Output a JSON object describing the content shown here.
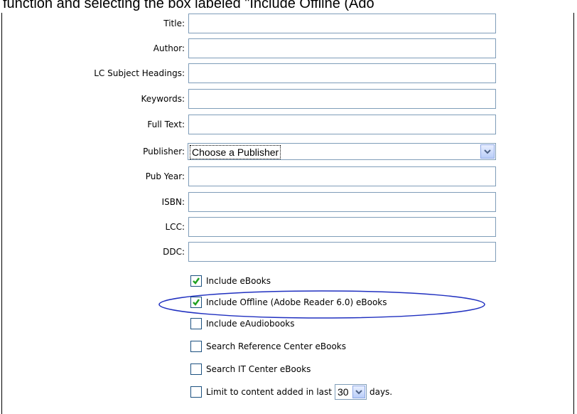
{
  "caption": "function and selecting the box labeled \"Include Offline (Ado",
  "fields": [
    {
      "label": "Title:",
      "value": ""
    },
    {
      "label": "Author:",
      "value": ""
    },
    {
      "label": "LC Subject Headings:",
      "value": ""
    },
    {
      "label": "Keywords:",
      "value": ""
    },
    {
      "label": "Full Text:",
      "value": ""
    },
    {
      "label": "Pub Year:",
      "value": ""
    },
    {
      "label": "ISBN:",
      "value": ""
    },
    {
      "label": "LCC:",
      "value": ""
    },
    {
      "label": "DDC:",
      "value": ""
    }
  ],
  "publisher": {
    "label": "Publisher:",
    "selected": "Choose a Publisher"
  },
  "checkboxes": [
    {
      "label": "Include eBooks",
      "checked": true
    },
    {
      "label": "Include Offline (Adobe Reader 6.0) eBooks",
      "checked": true,
      "highlighted": true
    },
    {
      "label": "Include eAudiobooks",
      "checked": false
    },
    {
      "label": "Search Reference Center eBooks",
      "checked": false
    },
    {
      "label": "Search IT Center eBooks",
      "checked": false
    }
  ],
  "limit": {
    "prefix": "Limit to content added in last",
    "days": "30",
    "suffix": "days.",
    "checked": false
  },
  "colors": {
    "highlight_ellipse": "#2030c0",
    "checkmark": "#21a121",
    "field_border": "#7f9db9"
  }
}
